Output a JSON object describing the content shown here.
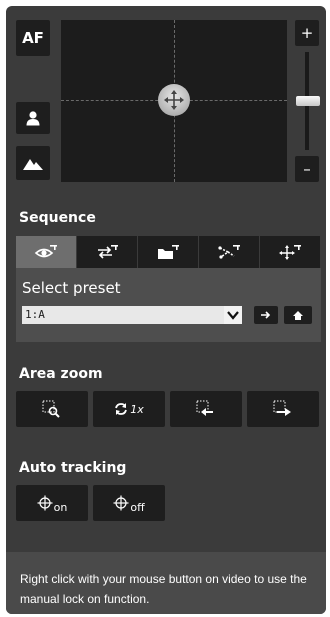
{
  "ptz": {
    "af_label": "AF",
    "zoom_plus_label": "+",
    "zoom_minus_label": "–",
    "zoom_level_fraction": 0.5,
    "icons": [
      "person-icon",
      "mountain-icon",
      "move-cross-icon"
    ]
  },
  "sequence": {
    "title": "Sequence",
    "tabs": [
      {
        "name": "preset-view",
        "icon": "eye-icon",
        "active": true
      },
      {
        "name": "swap",
        "icon": "swap-arrows-icon",
        "active": false
      },
      {
        "name": "folder",
        "icon": "folder-icon",
        "active": false
      },
      {
        "name": "tour",
        "icon": "tour-icon",
        "active": false
      },
      {
        "name": "move",
        "icon": "move-icon",
        "active": false
      }
    ],
    "preset_label": "Select preset",
    "preset_value": "1:A"
  },
  "area_zoom": {
    "title": "Area zoom",
    "reset_label": "1x"
  },
  "auto_tracking": {
    "title": "Auto tracking",
    "on_label": "on",
    "off_label": "off"
  },
  "footer": {
    "message": "Right click with your mouse button on video to use the manual lock on function."
  },
  "colors": {
    "panel": "#3b3b3b",
    "button": "#1e1e1e",
    "active_tab": "#6e6e6e",
    "text": "#ffffff"
  }
}
